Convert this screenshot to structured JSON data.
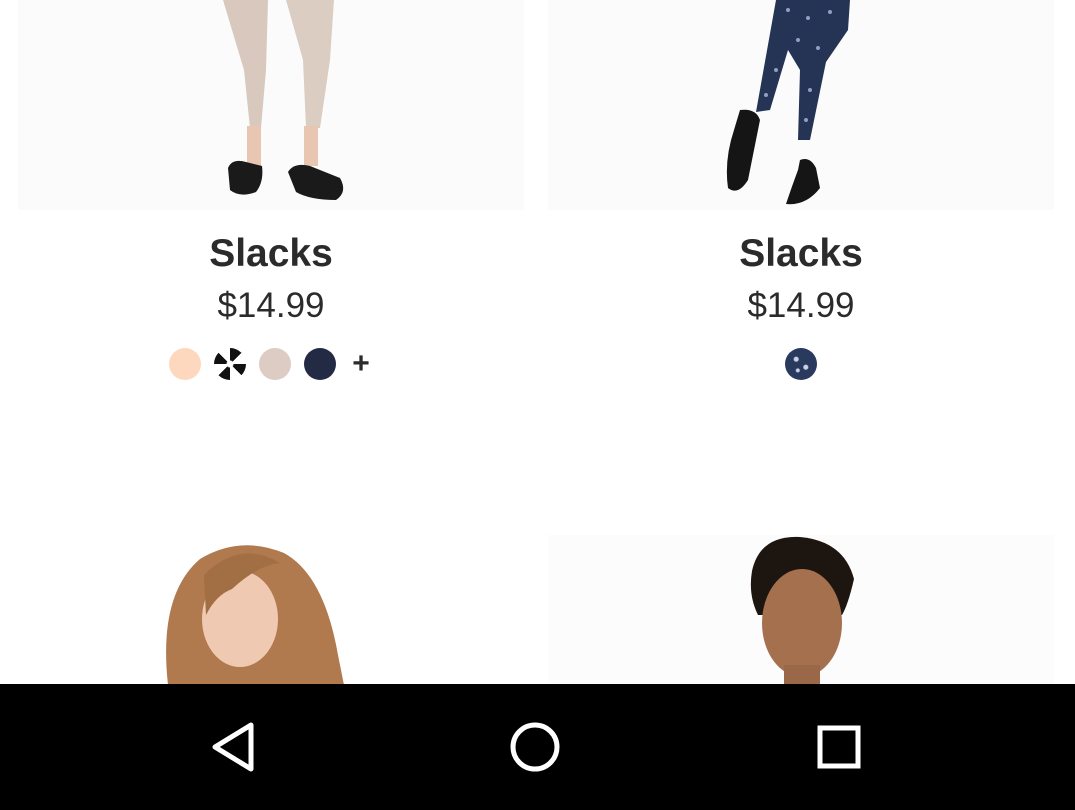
{
  "products": [
    {
      "title": "Slacks",
      "price": "$14.99",
      "swatches": [
        {
          "name": "peach-swatch",
          "color": "#fdd8bf"
        },
        {
          "name": "black-white-pattern-swatch",
          "color": "#1e1e1e"
        },
        {
          "name": "beige-swatch",
          "color": "#dcccc3"
        },
        {
          "name": "navy-swatch",
          "color": "#232b44"
        }
      ],
      "more_label": "+"
    },
    {
      "title": "Slacks",
      "price": "$14.99",
      "swatches": [
        {
          "name": "navy-print-swatch",
          "color": "#2a3a5e"
        }
      ]
    }
  ],
  "colors": {
    "navbar_bg": "#000000",
    "nav_icon": "#ffffff",
    "text": "#2b2b2b"
  },
  "navbar": {
    "icons": [
      "back-icon",
      "home-icon",
      "recents-icon"
    ]
  }
}
